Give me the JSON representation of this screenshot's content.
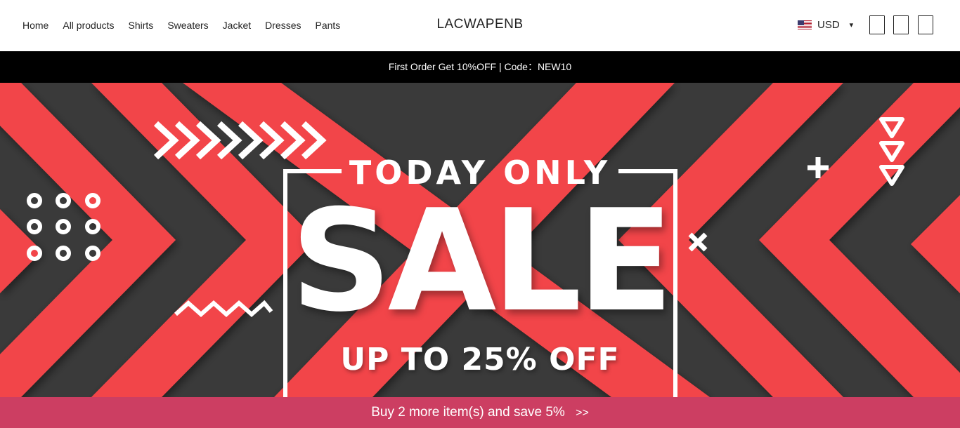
{
  "nav": {
    "items": [
      {
        "label": "Home"
      },
      {
        "label": "All products"
      },
      {
        "label": "Shirts"
      },
      {
        "label": "Sweaters"
      },
      {
        "label": "Jacket"
      },
      {
        "label": "Dresses"
      },
      {
        "label": "Pants"
      }
    ]
  },
  "brand": {
    "logo_text": "LACWAPENB"
  },
  "currency": {
    "selected": "USD",
    "flag_icon": "us-flag-icon",
    "caret_icon": "chevron-down-icon"
  },
  "header_icons": [
    "search-icon",
    "account-icon",
    "cart-icon"
  ],
  "announcement": {
    "text": "First Order Get 10%OFF | Code：NEW10"
  },
  "banner": {
    "headline": "TODAY ONLY",
    "big_text": "SALE",
    "sub_text": "UP TO 25% OFF",
    "colors": {
      "red": "#f24548",
      "dark": "#3a3a3a",
      "white": "#ffffff"
    }
  },
  "promo_bar": {
    "text": "Buy 2 more item(s) and save 5%",
    "arrow": ">>",
    "color": "#cc3e62"
  }
}
